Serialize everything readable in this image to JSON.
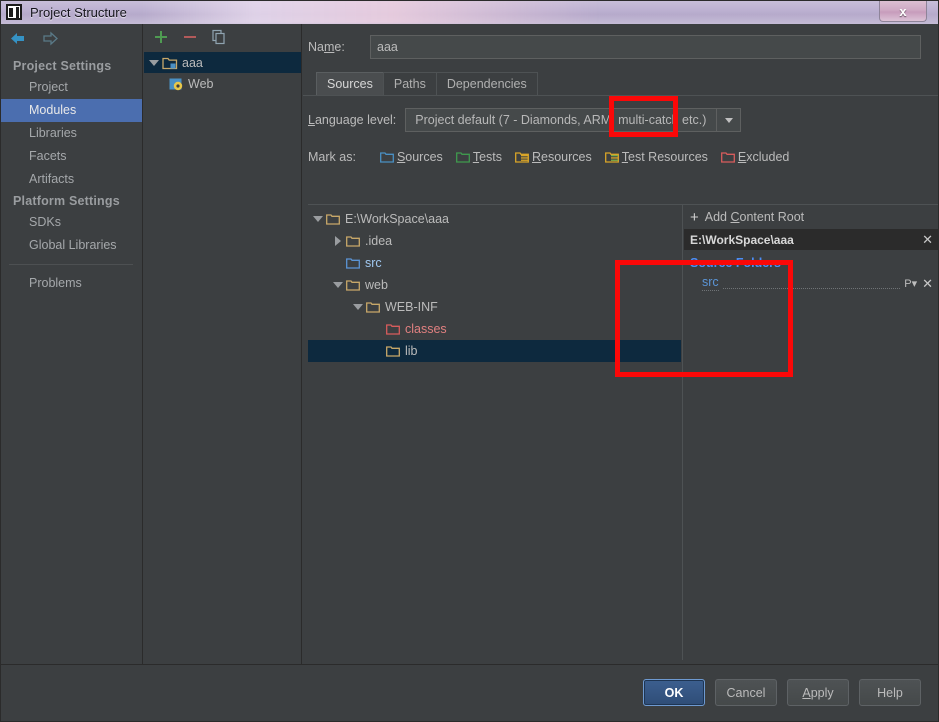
{
  "window": {
    "title": "Project Structure",
    "logo_icon": "intellij-idea-logo-icon",
    "close_label": "x"
  },
  "sidebar": {
    "back_icon": "back-arrow-icon",
    "forward_icon": "forward-arrow-icon",
    "groups": [
      {
        "title": "Project Settings",
        "items": [
          {
            "label": "Project",
            "selected": false
          },
          {
            "label": "Modules",
            "selected": true
          },
          {
            "label": "Libraries",
            "selected": false
          },
          {
            "label": "Facets",
            "selected": false
          },
          {
            "label": "Artifacts",
            "selected": false
          }
        ]
      },
      {
        "title": "Platform Settings",
        "items": [
          {
            "label": "SDKs",
            "selected": false
          },
          {
            "label": "Global Libraries",
            "selected": false
          }
        ]
      }
    ],
    "problems": {
      "label": "Problems"
    }
  },
  "modules_panel": {
    "toolbar": {
      "add_icon": "plus-icon",
      "remove_icon": "minus-icon",
      "copy_icon": "copy-icon"
    },
    "tree": [
      {
        "label": "aaa",
        "icon": "module-icon",
        "selected": true,
        "expanded": true,
        "depth": 0
      },
      {
        "label": "Web",
        "icon": "web-facet-icon",
        "selected": false,
        "depth": 1
      }
    ]
  },
  "main": {
    "name_field": {
      "label": "Na",
      "label_underline": "m",
      "label_end": "e:",
      "value": "aaa"
    },
    "tabs": [
      {
        "label": "Sources",
        "active": true
      },
      {
        "label": "Paths",
        "active": false
      },
      {
        "label": "Dependencies",
        "active": false
      }
    ],
    "language_level": {
      "label_start": "",
      "label_underline": "L",
      "label_end": "anguage level:",
      "value": "Project default (7 - Diamonds, ARM, multi-catch etc.)",
      "dropdown_icon": "chevron-down-icon"
    },
    "mark_as": {
      "label": "Mark as:",
      "options": [
        {
          "pre": "",
          "key": "S",
          "post": "ources",
          "color": "#4a90c4",
          "icon": "sources-folder-icon"
        },
        {
          "pre": "",
          "key": "T",
          "post": "ests",
          "color": "#3f9a4e",
          "icon": "tests-folder-icon"
        },
        {
          "pre": "",
          "key": "R",
          "post": "esources",
          "color": "#d9a528",
          "icon": "resources-folder-icon"
        },
        {
          "pre": "",
          "key": "T",
          "post": "est Resources",
          "color": "#d9a528",
          "icon": "test-resources-folder-icon"
        },
        {
          "pre": "",
          "key": "E",
          "post": "xcluded",
          "color": "#d85c5c",
          "icon": "excluded-folder-icon"
        }
      ]
    },
    "content_tree": [
      {
        "label": "E:\\WorkSpace\\aaa",
        "depth": 0,
        "expander": "down",
        "folder_color": "#c8a869",
        "style": "normal",
        "selected": false
      },
      {
        "label": ".idea",
        "depth": 1,
        "expander": "right",
        "folder_color": "#c8a869",
        "style": "normal",
        "selected": false
      },
      {
        "label": "src",
        "depth": 1,
        "expander": "none",
        "folder_color": "#5b95d6",
        "style": "sources",
        "selected": false
      },
      {
        "label": "web",
        "depth": 1,
        "expander": "down",
        "folder_color": "#c8a869",
        "style": "normal",
        "selected": false
      },
      {
        "label": "WEB-INF",
        "depth": 2,
        "expander": "down",
        "folder_color": "#c8a869",
        "style": "normal",
        "selected": false
      },
      {
        "label": "classes",
        "depth": 3,
        "expander": "none",
        "folder_color": "#d85c5c",
        "style": "excluded",
        "selected": false
      },
      {
        "label": "lib",
        "depth": 3,
        "expander": "none",
        "folder_color": "#c8a869",
        "style": "normal",
        "selected": true
      }
    ],
    "right_panel": {
      "add_content_root": {
        "pre": "Add ",
        "key": "C",
        "post": "ontent Root",
        "icon": "plus-icon"
      },
      "content_root": {
        "path": "E:\\WorkSpace\\aaa",
        "remove_icon": "close-icon"
      },
      "source_folders_title": "Source Folders",
      "source_folders": [
        {
          "name": "src",
          "package_prefix_icon": "package-prefix-icon",
          "remove_icon": "close-icon"
        }
      ]
    }
  },
  "annotations": [
    {
      "name": "sources-tab-highlight",
      "color": "#fb0808"
    },
    {
      "name": "web-inf-tree-highlight",
      "color": "#fb0808"
    }
  ],
  "footer": {
    "buttons": [
      {
        "label": "OK",
        "primary": true,
        "key": ""
      },
      {
        "label": "Cancel",
        "primary": false,
        "key": ""
      },
      {
        "pre": "",
        "key": "A",
        "post": "pply",
        "label": "Apply",
        "primary": false
      },
      {
        "label": "Help",
        "primary": false,
        "key": ""
      }
    ]
  }
}
